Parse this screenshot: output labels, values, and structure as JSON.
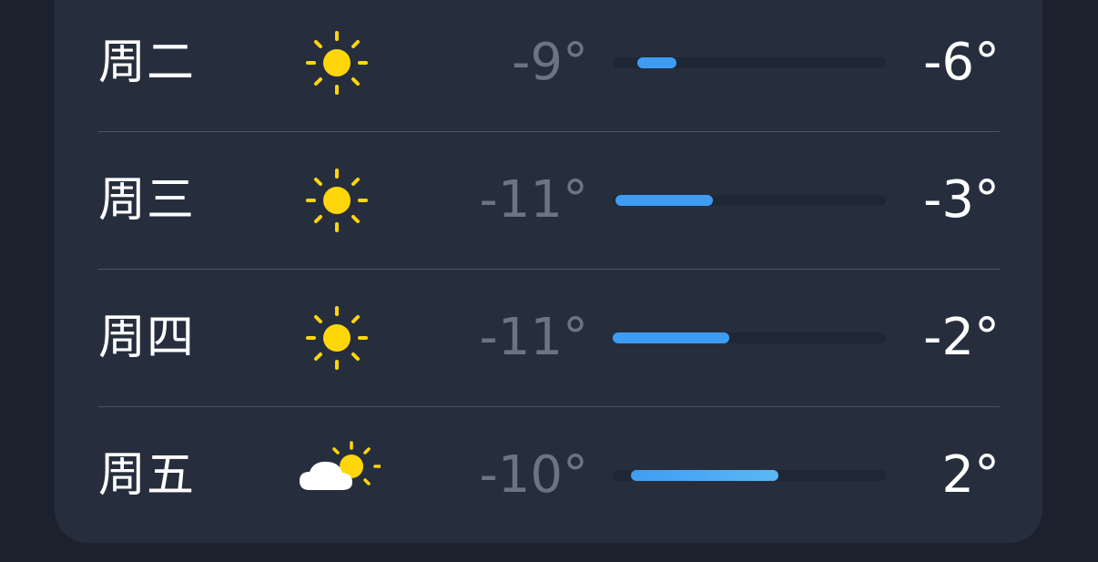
{
  "forecast": {
    "range_min": -11,
    "range_max": 2,
    "days": [
      {
        "day": "周二",
        "icon": "sun-icon",
        "low": "-9°",
        "high": "-6°",
        "low_value": -9,
        "high_value": -6
      },
      {
        "day": "周三",
        "icon": "sun-icon",
        "low": "-11°",
        "high": "-3°",
        "low_value": -11,
        "high_value": -3
      },
      {
        "day": "周四",
        "icon": "sun-icon",
        "low": "-11°",
        "high": "-2°",
        "low_value": -11,
        "high_value": -2
      },
      {
        "day": "周五",
        "icon": "partly-cloudy-icon",
        "low": "-10°",
        "high": "2°",
        "low_value": -10,
        "high_value": 2
      }
    ]
  },
  "colors": {
    "background": "#1c222d",
    "card": "#262e3e",
    "sun": "#ffd60a",
    "bar_cold": "#3d9df4",
    "bar_warm": "#5ab8f5",
    "low_text": "#6c7381",
    "high_text": "#ffffff"
  }
}
